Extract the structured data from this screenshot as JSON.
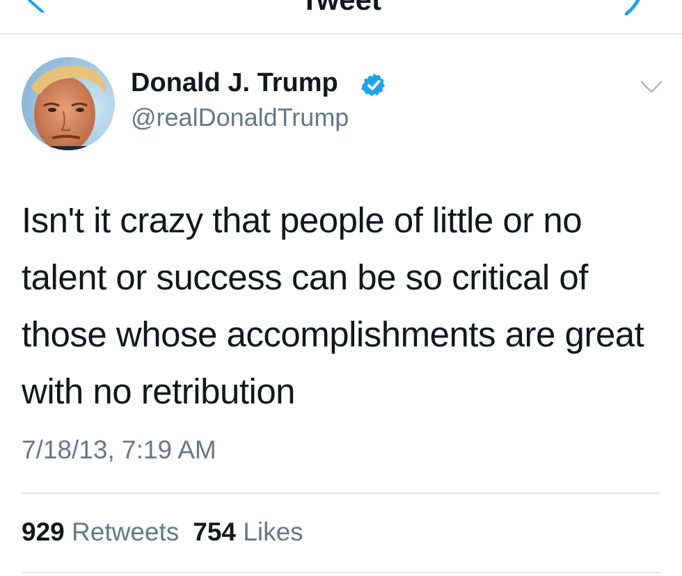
{
  "header": {
    "title": "Tweet"
  },
  "tweet": {
    "author": {
      "display_name": "Donald J. Trump",
      "handle": "@realDonaldTrump",
      "verified": true
    },
    "text": "Isn't it crazy that people of little or no talent or success can be so critical of those whose accomplishments are great with no retribution",
    "timestamp": "7/18/13, 7:19 AM",
    "stats": {
      "retweets_count": "929",
      "retweets_label": "Retweets",
      "likes_count": "754",
      "likes_label": "Likes"
    }
  },
  "colors": {
    "accent": "#1da1f2",
    "text_primary": "#14171a",
    "text_secondary": "#657786",
    "divider": "#e1e8ed"
  },
  "icons": {
    "back": "chevron-left-icon",
    "verified": "verified-badge-icon",
    "menu": "chevron-down-icon"
  }
}
